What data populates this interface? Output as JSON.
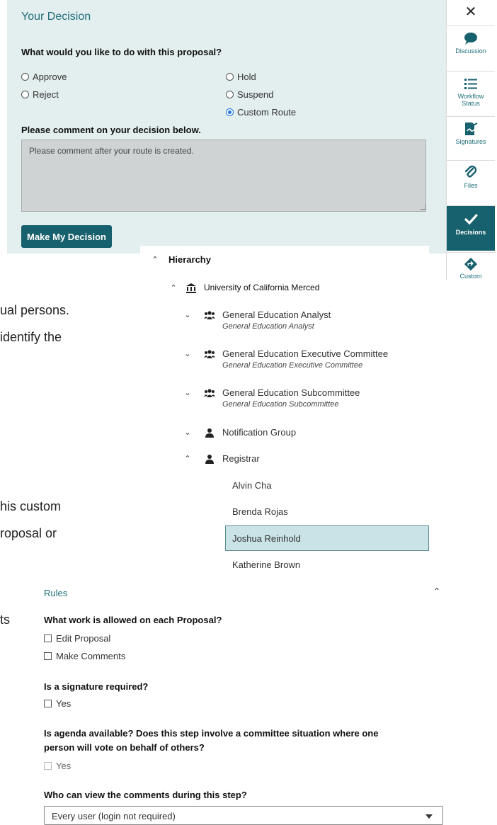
{
  "decision": {
    "title": "Your Decision",
    "question": "What would you like to do with this proposal?",
    "options": {
      "approve": "Approve",
      "reject": "Reject",
      "hold": "Hold",
      "suspend": "Suspend",
      "custom_route": "Custom Route"
    },
    "selected_option": "Custom Route",
    "comment_label": "Please comment on your decision below.",
    "comment_value": "Please comment after your route is created.",
    "submit_label": "Make My Decision"
  },
  "toolbar": {
    "close": "✕",
    "items": [
      {
        "label": "Discussion",
        "icon": "speech-bubble-icon"
      },
      {
        "label": "Workflow Status",
        "icon": "list-icon"
      },
      {
        "label": "Signatures",
        "icon": "signature-icon"
      },
      {
        "label": "Files",
        "icon": "paperclip-icon"
      },
      {
        "label": "Decisions",
        "icon": "check-icon",
        "active": true
      },
      {
        "label": "Custom",
        "icon": "route-icon"
      }
    ]
  },
  "hierarchy": {
    "title": "Hierarchy",
    "root": "University of California Merced",
    "groups": [
      {
        "name": "General Education Analyst",
        "sub": "General Education Analyst"
      },
      {
        "name": "General Education Executive Committee",
        "sub": "General Education Executive Committee"
      },
      {
        "name": "General Education Subcommittee",
        "sub": "General Education Subcommittee"
      },
      {
        "name": "Notification Group",
        "sub": ""
      },
      {
        "name": "Registrar",
        "sub": ""
      }
    ],
    "people": [
      "Alvin Cha",
      "Brenda Rojas",
      "Joshua Reinhold",
      "Katherine Brown"
    ],
    "selected_person": "Joshua Reinhold"
  },
  "background_text": {
    "l1": "ual persons.",
    "l2": " identify the",
    "l3": "his custom",
    "l4": "roposal or",
    "l5": "ts"
  },
  "rules": {
    "title": "Rules",
    "q_work": "What work is allowed on each Proposal?",
    "edit_proposal": "Edit Proposal",
    "make_comments": "Make Comments",
    "q_signature": "Is a signature required?",
    "signature_yes": "Yes",
    "q_agenda_1": "Is agenda available? Does this step involve a committee situation where one",
    "q_agenda_2": "person will vote on behalf of others?",
    "agenda_yes": "Yes",
    "q_view": "Who can view the comments during this step?",
    "view_value": "Every user (login not required)"
  },
  "colors": {
    "accent": "#17606d",
    "panel_bg": "#e3eeee",
    "selected_row": "#c9e3e6"
  }
}
